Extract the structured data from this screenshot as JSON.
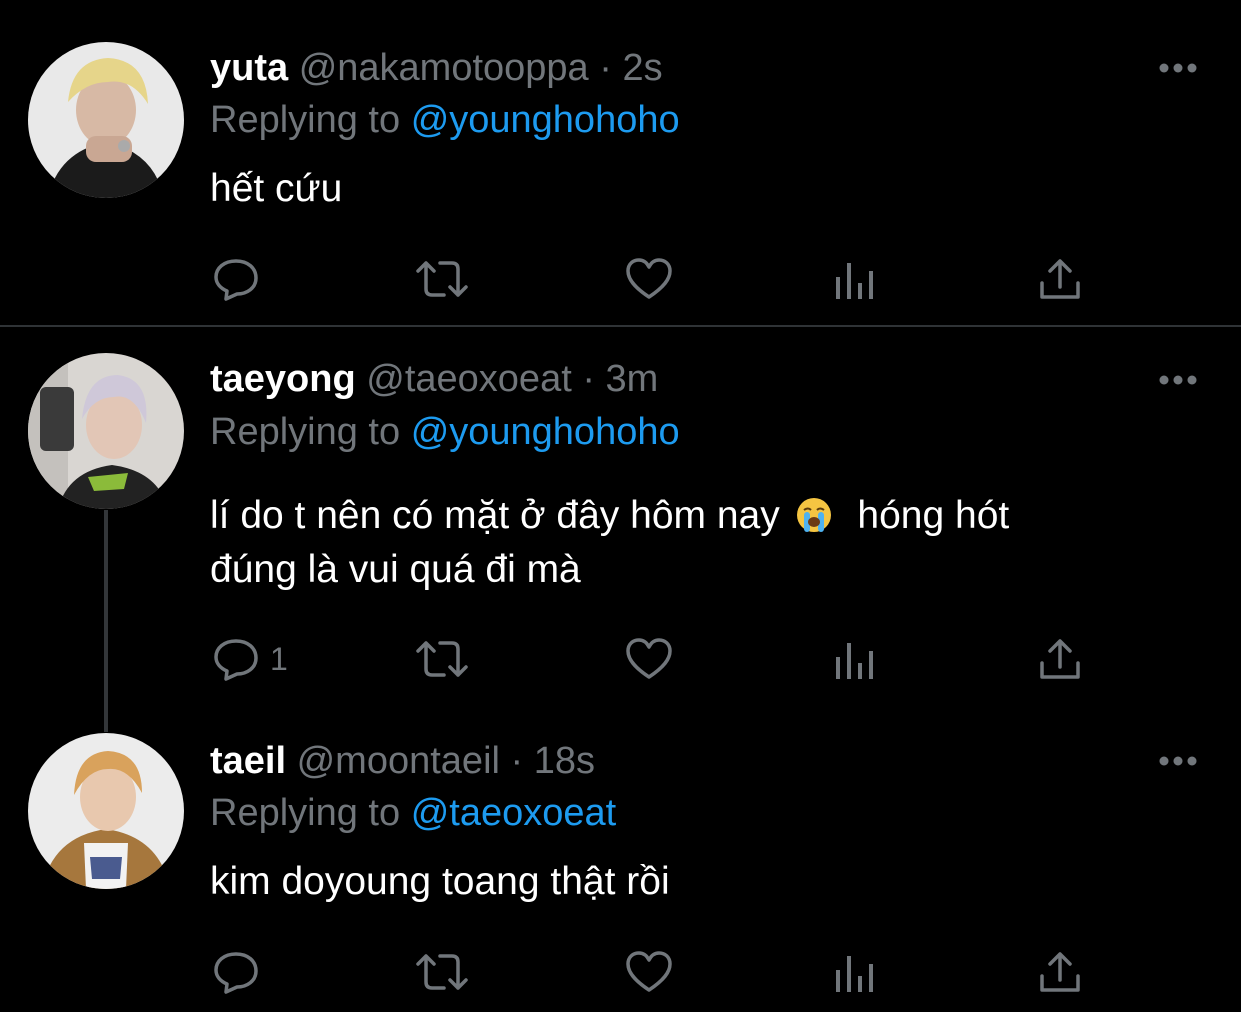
{
  "tweets": [
    {
      "display_name": "yuta",
      "handle": "@nakamotooppa",
      "time": "2s",
      "replying_label": "Replying to",
      "replying_to": "@younghohoho",
      "text": "hết cứu",
      "reply_count": ""
    },
    {
      "display_name": "taeyong",
      "handle": "@taeoxoeat",
      "time": "3m",
      "replying_label": "Replying to",
      "replying_to": "@younghohoho",
      "text_part1": "lí do t nên có mặt ở đây hôm nay",
      "text_emoji": "loudly-crying-face-emoji",
      "text_part2": "hóng hót",
      "text_line2": "đúng là vui quá đi mà",
      "reply_count": "1"
    },
    {
      "display_name": "taeil",
      "handle": "@moontaeil",
      "time": "18s",
      "replying_label": "Replying to",
      "replying_to": "@taeoxoeat",
      "text": "kim doyoung toang thật rồi",
      "reply_count": ""
    }
  ],
  "separator": " · ",
  "icons": {
    "reply": "reply-icon",
    "retweet": "retweet-icon",
    "like": "heart-icon",
    "analytics": "analytics-icon",
    "share": "share-icon",
    "more": "more-icon"
  },
  "colors": {
    "background": "#000000",
    "text": "#ffffff",
    "muted": "#71767b",
    "accent": "#1d9bf0",
    "divider": "#2f3336"
  }
}
